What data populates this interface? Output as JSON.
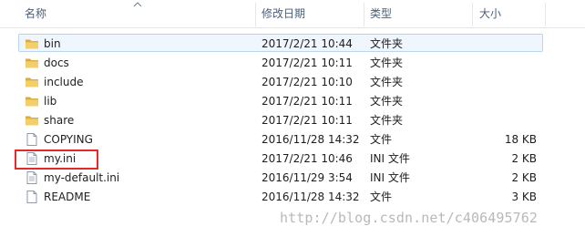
{
  "header": {
    "name": "名称",
    "date": "修改日期",
    "type": "类型",
    "size": "大小"
  },
  "files": [
    {
      "name": "bin",
      "date": "2017/2/21 10:44",
      "type": "文件夹",
      "size": "",
      "icon": "folder-icon",
      "selected": true
    },
    {
      "name": "docs",
      "date": "2017/2/21 10:11",
      "type": "文件夹",
      "size": "",
      "icon": "folder-icon"
    },
    {
      "name": "include",
      "date": "2017/2/21 10:10",
      "type": "文件夹",
      "size": "",
      "icon": "folder-icon"
    },
    {
      "name": "lib",
      "date": "2017/2/21 10:11",
      "type": "文件夹",
      "size": "",
      "icon": "folder-icon"
    },
    {
      "name": "share",
      "date": "2017/2/21 10:11",
      "type": "文件夹",
      "size": "",
      "icon": "folder-icon"
    },
    {
      "name": "COPYING",
      "date": "2016/11/28 14:32",
      "type": "文件",
      "size": "18 KB",
      "icon": "file-icon"
    },
    {
      "name": "my.ini",
      "date": "2017/2/21 10:46",
      "type": "INI 文件",
      "size": "2 KB",
      "icon": "ini-file-icon",
      "highlighted": true
    },
    {
      "name": "my-default.ini",
      "date": "2016/11/29 3:54",
      "type": "INI 文件",
      "size": "2 KB",
      "icon": "ini-file-icon"
    },
    {
      "name": "README",
      "date": "2016/11/28 14:32",
      "type": "文件",
      "size": "3 KB",
      "icon": "file-icon"
    }
  ],
  "watermark": "http://blog.csdn.net/c406495762",
  "colors": {
    "header_text": "#4c607a",
    "selection_bg": "#f0f6fd",
    "selection_border": "#b9d5ee",
    "highlight_box": "#e32a2a",
    "folder": "#e8c35c"
  }
}
